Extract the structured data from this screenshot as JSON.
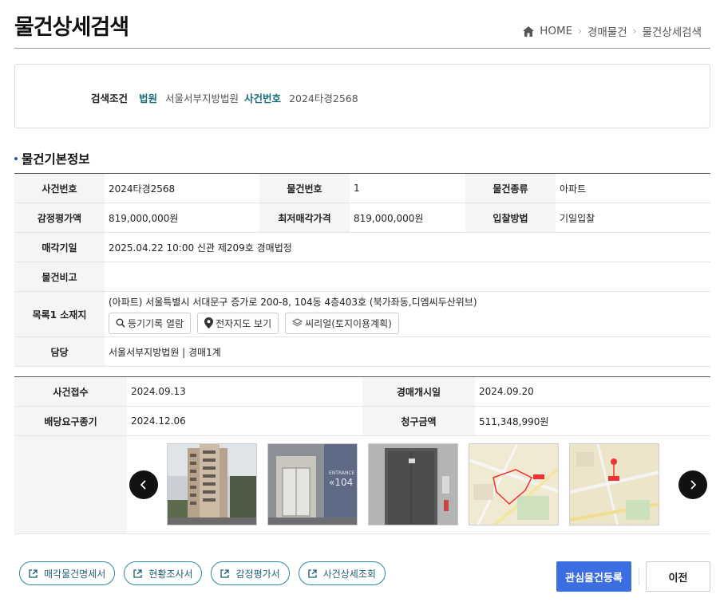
{
  "page": {
    "title": "물건상세검색"
  },
  "breadcrumb": {
    "home": "HOME",
    "level1": "경매물건",
    "level2": "물건상세검색"
  },
  "search": {
    "label": "검색조건",
    "court_key": "법원",
    "court_value": "서울서부지방법원",
    "case_key": "사건번호",
    "case_value": "2024타경2568"
  },
  "section": {
    "title": "물건기본정보"
  },
  "basic": {
    "case_no_label": "사건번호",
    "case_no": "2024타경2568",
    "item_no_label": "물건번호",
    "item_no": "1",
    "item_type_label": "물건종류",
    "item_type": "아파트",
    "appraisal_label": "감정평가액",
    "appraisal": "819,000,000원",
    "min_price_label": "최저매각가격",
    "min_price": "819,000,000원",
    "bid_method_label": "입찰방법",
    "bid_method": "기일입찰",
    "sale_date_label": "매각기일",
    "sale_date": "2025.04.22 10:00 신관 제209호 경매법정",
    "note_label": "물건비고",
    "note": "",
    "location_label": "목록1 소재지",
    "location": "(아파트) 서울특별시 서대문구 증가로 200-8, 104동 4층403호 (북가좌동,디엠씨두산위브)",
    "btn_registry": "등기기록 열람",
    "btn_map": "전자지도 보기",
    "btn_land": "씨리얼(토지이용계획)",
    "charge_label": "담당",
    "charge": "서울서부지방법원 | 경매1계"
  },
  "case_info": {
    "receipt_label": "사건접수",
    "receipt": "2024.09.13",
    "start_label": "경매개시일",
    "start": "2024.09.20",
    "dividend_label": "배당요구종기",
    "dividend": "2024.12.06",
    "claim_label": "청구금액",
    "claim": "511,348,990원"
  },
  "gallery": {
    "icon_prev": "chevron-left-icon",
    "icon_next": "chevron-right-icon"
  },
  "actions": {
    "sale_statement": "매각물건명세서",
    "status_report": "현황조사서",
    "appraisal_report": "감정평가서",
    "case_detail": "사건상세조회",
    "favorite": "관심물건등록",
    "prev": "이전"
  },
  "colors": {
    "primary": "#3b6ee0",
    "accent": "#1a6e7c",
    "link_border": "#2d8aa0"
  }
}
